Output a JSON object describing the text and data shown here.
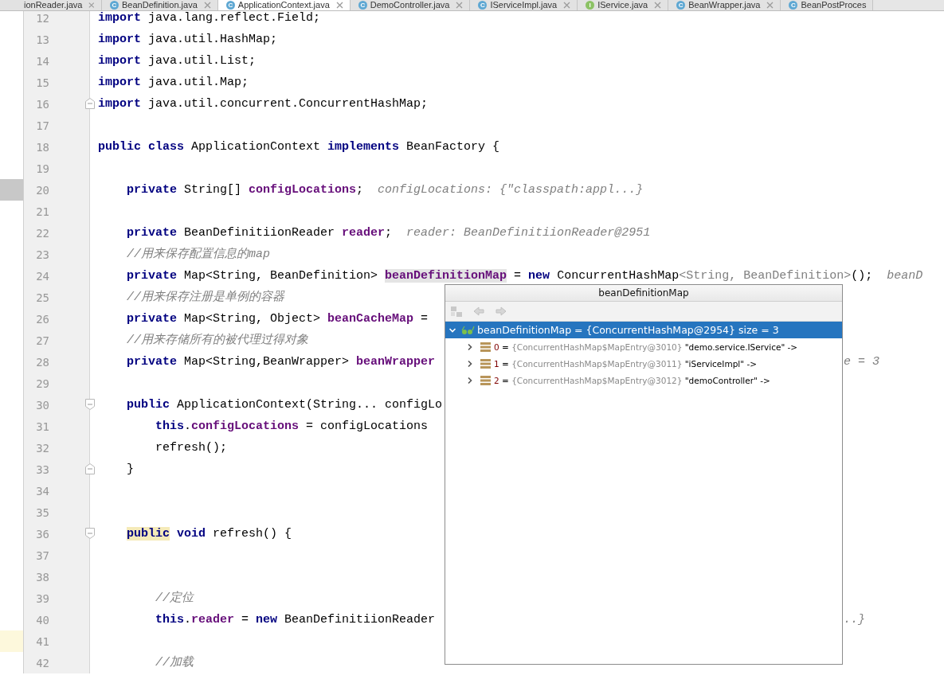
{
  "tabs": [
    {
      "label": "ionReader.java",
      "kind": "plain",
      "closable": true,
      "selected": false
    },
    {
      "label": "BeanDefinition.java",
      "kind": "class",
      "icon_letter": "C",
      "closable": true,
      "selected": false
    },
    {
      "label": "ApplicationContext.java",
      "kind": "class",
      "icon_letter": "C",
      "closable": true,
      "selected": true
    },
    {
      "label": "DemoController.java",
      "kind": "class",
      "icon_letter": "C",
      "closable": true,
      "selected": false
    },
    {
      "label": "IServiceImpl.java",
      "kind": "class",
      "icon_letter": "C",
      "closable": true,
      "selected": false
    },
    {
      "label": "IService.java",
      "kind": "interface",
      "icon_letter": "I",
      "closable": true,
      "selected": false
    },
    {
      "label": "BeanWrapper.java",
      "kind": "class",
      "icon_letter": "C",
      "closable": true,
      "selected": false
    },
    {
      "label": "BeanPostProces",
      "kind": "class",
      "icon_letter": "C",
      "closable": false,
      "selected": false
    }
  ],
  "editor": {
    "lines": [
      {
        "n": "12",
        "kind": "top",
        "tokens": [
          {
            "t": "import",
            "kind": "kw"
          },
          {
            "t": " java.lang.reflect.Field;",
            "kind": "plain"
          }
        ]
      },
      {
        "n": "13",
        "kind": "top",
        "tokens": [
          {
            "t": "import",
            "kind": "kw"
          },
          {
            "t": " java.util.HashMap;",
            "kind": "plain"
          }
        ]
      },
      {
        "n": "14",
        "kind": "top",
        "tokens": [
          {
            "t": "import",
            "kind": "kw"
          },
          {
            "t": " java.util.List;",
            "kind": "plain"
          }
        ]
      },
      {
        "n": "15",
        "kind": "top",
        "tokens": [
          {
            "t": "import",
            "kind": "kw"
          },
          {
            "t": " java.util.Map;",
            "kind": "plain"
          }
        ]
      },
      {
        "n": "16",
        "kind": "top",
        "fold_close": true,
        "tokens": [
          {
            "t": "import",
            "kind": "kw"
          },
          {
            "t": " java.util.concurrent.ConcurrentHashMap;",
            "kind": "plain"
          }
        ]
      },
      {
        "n": "17",
        "kind": "top"
      },
      {
        "n": "18",
        "kind": "top",
        "tokens": [
          {
            "t": "public class",
            "kind": "kw"
          },
          {
            "t": " ApplicationContext ",
            "kind": "plain"
          },
          {
            "t": "implements",
            "kind": "kw"
          },
          {
            "t": " BeanFactory {",
            "kind": "plain"
          }
        ]
      },
      {
        "n": "19",
        "kind": "top"
      },
      {
        "n": "20",
        "kind": "member",
        "color": "#c8c8c8",
        "tokens": [
          {
            "t": "private",
            "kind": "kw"
          },
          {
            "t": " String[] ",
            "kind": "plain"
          },
          {
            "t": "configLocations",
            "kind": "field"
          },
          {
            "t": ";",
            "kind": "plain"
          },
          {
            "t": "configLocations: {\"classpath:appl...}",
            "kind": "hint"
          }
        ]
      },
      {
        "n": "21",
        "kind": "top"
      },
      {
        "n": "22",
        "kind": "member",
        "tokens": [
          {
            "t": "private",
            "kind": "kw"
          },
          {
            "t": " BeanDefinitiionReader ",
            "kind": "plain"
          },
          {
            "t": "reader",
            "kind": "field"
          },
          {
            "t": ";",
            "kind": "plain"
          },
          {
            "t": "reader: BeanDefinitiionReader@2951",
            "kind": "hint"
          }
        ]
      },
      {
        "n": "23",
        "kind": "member",
        "tokens": [
          {
            "t": "//用来保存配置信息的map",
            "kind": "comment"
          }
        ]
      },
      {
        "n": "24",
        "kind": "member",
        "tokens": [
          {
            "t": "private",
            "kind": "kw"
          },
          {
            "t": " Map<String, BeanDefinition> ",
            "kind": "plain"
          },
          {
            "t": "beanDefinitionMap",
            "kind": "field",
            "hl": true
          },
          {
            "t": " = ",
            "kind": "plain"
          },
          {
            "t": "new",
            "kind": "kw"
          },
          {
            "t": " ConcurrentHashMap",
            "kind": "plain"
          },
          {
            "t": "<String, BeanDefinition>",
            "kind": "gen"
          },
          {
            "t": "();",
            "kind": "plain"
          },
          {
            "t": "beanD",
            "kind": "hint"
          }
        ]
      },
      {
        "n": "25",
        "kind": "member",
        "tokens": [
          {
            "t": "//用来保存注册是单例的容器",
            "kind": "comment"
          }
        ]
      },
      {
        "n": "26",
        "kind": "member",
        "tokens": [
          {
            "t": "private",
            "kind": "kw"
          },
          {
            "t": " Map<String, Object> ",
            "kind": "plain"
          },
          {
            "t": "beanCacheMap",
            "kind": "field"
          },
          {
            "t": " =",
            "kind": "plain"
          }
        ]
      },
      {
        "n": "27",
        "kind": "member",
        "tokens": [
          {
            "t": "//用来存储所有的被代理过得对象",
            "kind": "comment"
          }
        ]
      },
      {
        "n": "28",
        "kind": "member",
        "tokens": [
          {
            "t": "private",
            "kind": "kw"
          },
          {
            "t": " Map<String,BeanWrapper> ",
            "kind": "plain"
          },
          {
            "t": "beanWrapper",
            "kind": "field"
          }
        ],
        "right": [
          {
            "t": "e = 3",
            "kind": "hint"
          }
        ]
      },
      {
        "n": "29",
        "kind": "top"
      },
      {
        "n": "30",
        "kind": "member",
        "fold_open": true,
        "tokens": [
          {
            "t": "public",
            "kind": "kw"
          },
          {
            "t": " ApplicationContext(String... configLo",
            "kind": "plain"
          }
        ]
      },
      {
        "n": "31",
        "kind": "body",
        "tokens": [
          {
            "t": "this",
            "kind": "kw"
          },
          {
            "t": ".",
            "kind": "plain"
          },
          {
            "t": "configLocations",
            "kind": "field"
          },
          {
            "t": " = configLocations",
            "kind": "plain"
          }
        ]
      },
      {
        "n": "32",
        "kind": "body",
        "tokens": [
          {
            "t": "refresh();",
            "kind": "plain"
          }
        ]
      },
      {
        "n": "33",
        "kind": "member",
        "fold_close": true,
        "tokens": [
          {
            "t": "}",
            "kind": "plain"
          }
        ]
      },
      {
        "n": "34",
        "kind": "top"
      },
      {
        "n": "35",
        "kind": "top"
      },
      {
        "n": "36",
        "kind": "member",
        "fold_open": true,
        "tokens": [
          {
            "t": "public",
            "kind": "kw",
            "hl": true
          },
          {
            "t": " void",
            "kind": "kw"
          },
          {
            "t": " refresh() {",
            "kind": "plain"
          }
        ]
      },
      {
        "n": "37",
        "kind": "top"
      },
      {
        "n": "38",
        "kind": "top"
      },
      {
        "n": "39",
        "kind": "body",
        "tokens": [
          {
            "t": "//定位",
            "kind": "comment"
          }
        ]
      },
      {
        "n": "40",
        "kind": "body",
        "tokens": [
          {
            "t": "this",
            "kind": "kw"
          },
          {
            "t": ".",
            "kind": "plain"
          },
          {
            "t": "reader",
            "kind": "field"
          },
          {
            "t": " = ",
            "kind": "plain"
          },
          {
            "t": "new",
            "kind": "kw"
          },
          {
            "t": " BeanDefinitiionReader",
            "kind": "plain"
          }
        ],
        "right": [
          {
            "t": "..}",
            "kind": "hint"
          }
        ]
      },
      {
        "n": "41",
        "kind": "top",
        "color": "#fdf8dc"
      },
      {
        "n": "42",
        "kind": "body",
        "tokens": [
          {
            "t": "//加载",
            "kind": "comment"
          }
        ]
      }
    ]
  },
  "popup": {
    "title": "beanDefinitionMap",
    "root": {
      "text": "beanDefinitionMap = {ConcurrentHashMap@2954}  size = 3",
      "expanded": true,
      "selected": true
    },
    "children": [
      {
        "index": "0",
        "separator": "=",
        "type": "{ConcurrentHashMap$MapEntry@3010}",
        "value": "\"demo.service.IService\" ->",
        "expanded": false,
        "selected": false
      },
      {
        "index": "1",
        "separator": "=",
        "type": "{ConcurrentHashMap$MapEntry@3011}",
        "value": "\"iServiceImpl\" ->",
        "expanded": false,
        "selected": false
      },
      {
        "index": "2",
        "separator": "=",
        "type": "{ConcurrentHashMap$MapEntry@3012}",
        "value": "\"demoController\" ->",
        "expanded": false,
        "selected": false
      }
    ]
  }
}
